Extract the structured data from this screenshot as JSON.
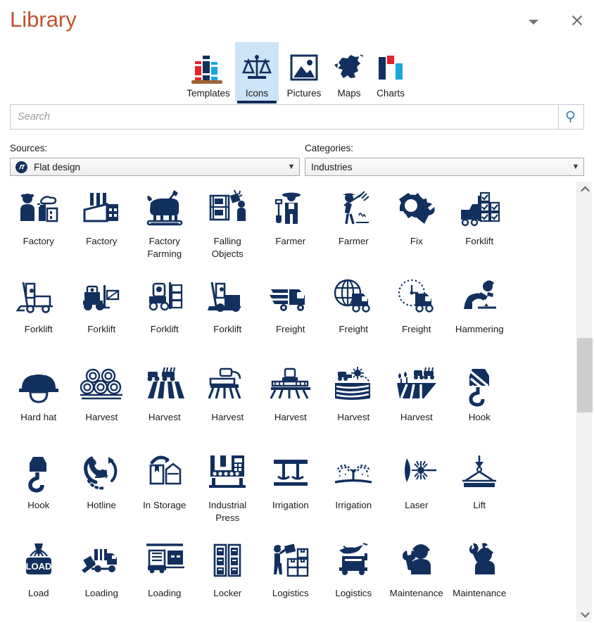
{
  "window": {
    "title": "Library",
    "minimize_icon": "chevron-down-icon",
    "close_icon": "close-icon"
  },
  "tabs": [
    {
      "label": "Templates",
      "icon": "books-icon",
      "selected": false
    },
    {
      "label": "Icons",
      "icon": "scales-icon",
      "selected": true
    },
    {
      "label": "Pictures",
      "icon": "picture-icon",
      "selected": false
    },
    {
      "label": "Maps",
      "icon": "map-icon",
      "selected": false
    },
    {
      "label": "Charts",
      "icon": "chart-icon",
      "selected": false
    }
  ],
  "search": {
    "value": "",
    "placeholder": "Search",
    "button_icon": "search-icon"
  },
  "selectors": {
    "sources_label": "Sources:",
    "sources_value": "Flat design",
    "sources_logo": "flat-design-logo-icon",
    "categories_label": "Categories:",
    "categories_value": "Industries",
    "arrow_icon": "chevron-down-icon"
  },
  "scrollbar": {
    "up_icon": "chevron-up-icon",
    "down_icon": "chevron-down-icon"
  },
  "colors": {
    "title": "#C0522E",
    "icon_navy": "#12305E",
    "tab_selected_bg": "#CCE4F7",
    "tab_underline": "#0F2D5C",
    "scroll_thumb": "#CDCDCD"
  },
  "grid": {
    "columns": 8,
    "items": [
      {
        "label": "Factory",
        "icon": "factory-worker-icon"
      },
      {
        "label": "Factory",
        "icon": "factory-building-icon"
      },
      {
        "label": "Factory Farming",
        "icon": "factory-farming-cow-icon"
      },
      {
        "label": "Falling Objects",
        "icon": "falling-objects-icon"
      },
      {
        "label": "Farmer",
        "icon": "farmer-shovel-icon"
      },
      {
        "label": "Farmer",
        "icon": "farmer-pitchfork-icon"
      },
      {
        "label": "Fix",
        "icon": "fix-gear-hand-icon"
      },
      {
        "label": "Forklift",
        "icon": "forklift-checked-pallets-icon"
      },
      {
        "label": "Forklift",
        "icon": "forklift-side-icon"
      },
      {
        "label": "Forklift",
        "icon": "forklift-crate-icon"
      },
      {
        "label": "Forklift",
        "icon": "forklift-stacked-boxes-icon"
      },
      {
        "label": "Forklift",
        "icon": "forklift-mast-icon"
      },
      {
        "label": "Freight",
        "icon": "freight-fast-truck-icon"
      },
      {
        "label": "Freight",
        "icon": "freight-globe-truck-icon"
      },
      {
        "label": "Freight",
        "icon": "freight-clock-truck-icon"
      },
      {
        "label": "Hammering",
        "icon": "hammering-worker-icon"
      },
      {
        "label": "Hard hat",
        "icon": "hard-hat-icon"
      },
      {
        "label": "Harvest",
        "icon": "harvest-hay-bales-icon"
      },
      {
        "label": "Harvest",
        "icon": "harvest-tractor-trailer-icon"
      },
      {
        "label": "Harvest",
        "icon": "harvest-combine-icon"
      },
      {
        "label": "Harvest",
        "icon": "harvest-tractor-front-icon"
      },
      {
        "label": "Harvest",
        "icon": "harvest-field-sun-icon"
      },
      {
        "label": "Harvest",
        "icon": "harvest-field-road-icon"
      },
      {
        "label": "Hook",
        "icon": "hook-striped-icon"
      },
      {
        "label": "Hook",
        "icon": "hook-solid-icon"
      },
      {
        "label": "Hotline",
        "icon": "hotline-24-icon"
      },
      {
        "label": "In Storage",
        "icon": "in-storage-icon"
      },
      {
        "label": "Industrial Press",
        "icon": "industrial-press-icon"
      },
      {
        "label": "Irrigation",
        "icon": "irrigation-drip-icon"
      },
      {
        "label": "Irrigation",
        "icon": "irrigation-sprinkler-icon"
      },
      {
        "label": "Laser",
        "icon": "laser-icon"
      },
      {
        "label": "Lift",
        "icon": "lift-icon"
      },
      {
        "label": "Load",
        "icon": "load-crate-icon"
      },
      {
        "label": "Loading",
        "icon": "loading-truck-ramp-icon"
      },
      {
        "label": "Loading",
        "icon": "loading-dock-icon"
      },
      {
        "label": "Locker",
        "icon": "locker-icon"
      },
      {
        "label": "Logistics",
        "icon": "logistics-worker-boxes-icon"
      },
      {
        "label": "Logistics",
        "icon": "logistics-plane-truck-icon"
      },
      {
        "label": "Maintenance",
        "icon": "maintenance-wrench-worker-icon"
      },
      {
        "label": "Maintenance",
        "icon": "maintenance-tool-worker-icon"
      }
    ]
  }
}
